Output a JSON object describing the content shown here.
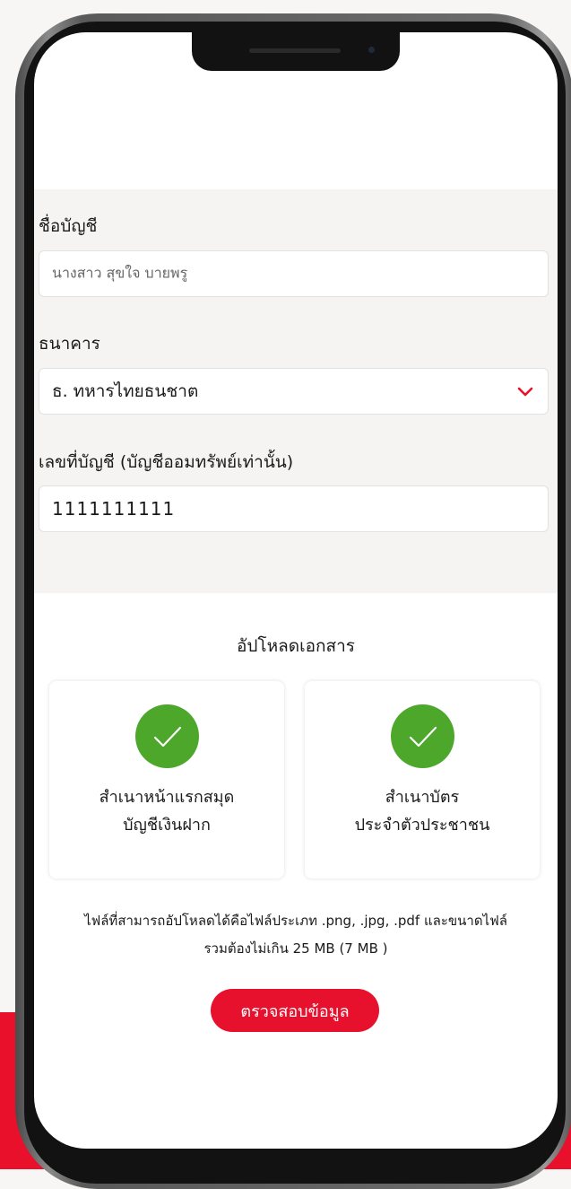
{
  "form": {
    "account_name": {
      "label": "ชื่อบัญชี",
      "value": "นางสาว สุขใจ บายพรู"
    },
    "bank": {
      "label": "ธนาคาร",
      "selected": "ธ. ทหารไทยธนชาต"
    },
    "account_number": {
      "label": "เลขที่บัญชี (บัญชีออมทรัพย์เท่านั้น)",
      "value": "1111111111"
    }
  },
  "upload": {
    "title": "อัปโหลดเอกสาร",
    "cards": [
      {
        "line1": "สำเนาหน้าแรกสมุด",
        "line2": "บัญชีเงินฝาก",
        "status_icon": "check-icon"
      },
      {
        "line1": "สำเนาบัตร",
        "line2": "ประจำตัวประชาชน",
        "status_icon": "check-icon"
      }
    ],
    "note_line1": "ไฟล์ที่สามารถอัปโหลดได้คือไฟล์ประเภท .png, .jpg, .pdf และขนาดไฟล์",
    "note_line2": "รวมต้องไม่เกิน 25 MB (7 MB )"
  },
  "submit_label": "ตรวจสอบข้อมูล",
  "colors": {
    "accent": "#e8112d",
    "success": "#4ca72b",
    "chevron": "#e8112d"
  }
}
